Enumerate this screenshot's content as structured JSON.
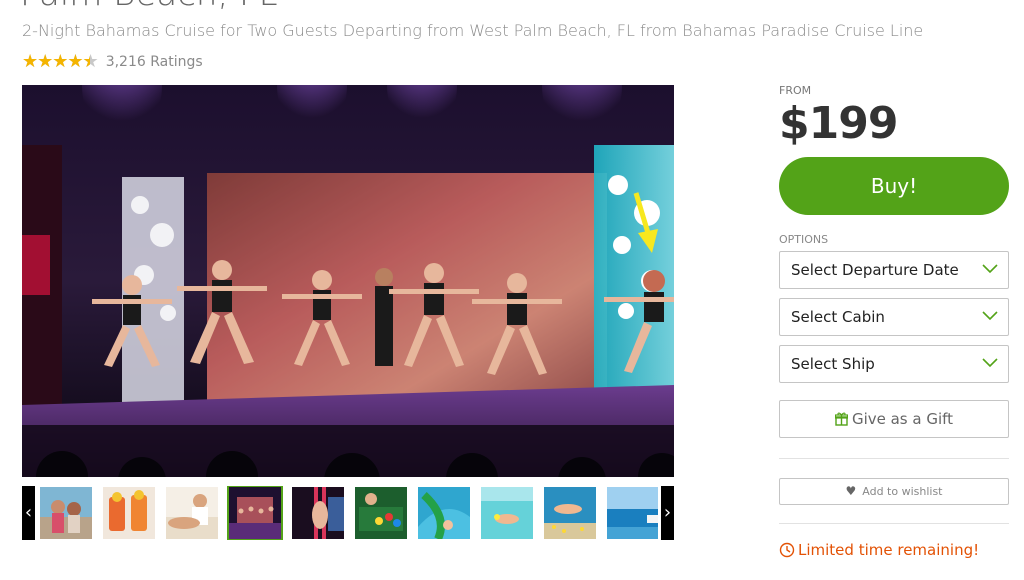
{
  "deal": {
    "title": "Palm Beach, FL",
    "subtitle": "2-Night Bahamas Cruise for Two Guests Departing from West Palm Beach, FL from Bahamas Paradise Cruise Line",
    "rating": {
      "stars": 4.5,
      "count_text": "3,216 Ratings"
    }
  },
  "gallery": {
    "prev_arrow": "‹",
    "next_arrow": "›",
    "thumbnails": [
      {
        "name": "thumb-women-on-deck",
        "selected": false
      },
      {
        "name": "thumb-cocktails",
        "selected": false
      },
      {
        "name": "thumb-spa-massage",
        "selected": false
      },
      {
        "name": "thumb-stage-show",
        "selected": true
      },
      {
        "name": "thumb-aerial-dancer",
        "selected": false
      },
      {
        "name": "thumb-casino-table",
        "selected": false
      },
      {
        "name": "thumb-water-slide",
        "selected": false
      },
      {
        "name": "thumb-snorkeling",
        "selected": false
      },
      {
        "name": "thumb-diver-fish",
        "selected": false
      },
      {
        "name": "thumb-ocean-view",
        "selected": false
      }
    ]
  },
  "purchase": {
    "from_label": "FROM",
    "price": "$199",
    "buy_label": "Buy!",
    "options_label": "OPTIONS",
    "selects": [
      {
        "label": "Select Departure Date"
      },
      {
        "label": "Select Cabin"
      },
      {
        "label": "Select Ship"
      }
    ],
    "gift_label": "Give as a Gift",
    "wishlist_label": "Add to wishlist",
    "limited_text": "Limited time remaining!"
  },
  "colors": {
    "accent_green": "#53a318",
    "star_gold": "#f4b400",
    "alert_orange": "#e35205"
  }
}
